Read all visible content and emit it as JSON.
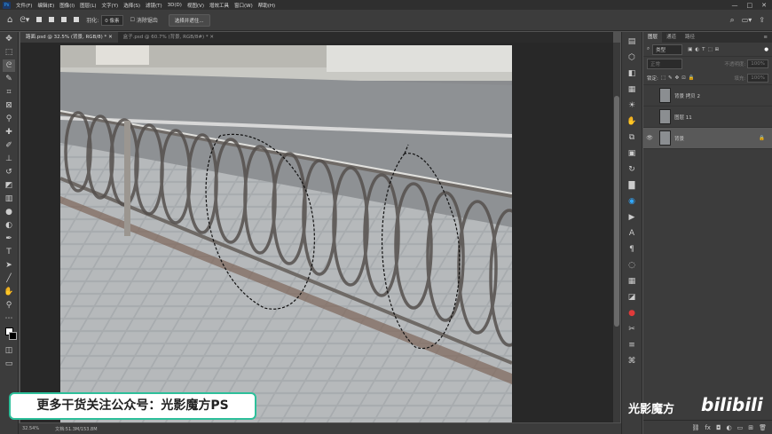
{
  "menu": {
    "app_icon": "Ps",
    "items": [
      "文件(F)",
      "编辑(E)",
      "图像(I)",
      "图层(L)",
      "文字(Y)",
      "选择(S)",
      "滤镜(T)",
      "3D(D)",
      "视图(V)",
      "增效工具",
      "窗口(W)",
      "帮助(H)"
    ]
  },
  "options": {
    "feather_label": "羽化:",
    "feather_value": "0 像素",
    "antialias_label": "消除锯齿",
    "select_subject": "选择并遮住..."
  },
  "tabs": [
    {
      "label": "路面.psd @ 32.5% (背景, RGB/8) *"
    },
    {
      "label": "盒子.psd @ 60.7% (背景, RGB/8#) *"
    }
  ],
  "layers_panel": {
    "tabs": [
      "图层",
      "通道",
      "路径"
    ],
    "filter_label": "类型",
    "blend_mode": "正常",
    "opacity_label": "不透明度:",
    "opacity_value": "100%",
    "lock_label": "锁定:",
    "fill_label": "填充:",
    "fill_value": "100%",
    "layers": [
      {
        "name": "背景 拷贝 2",
        "visible": false,
        "selected": false
      },
      {
        "name": "图层 11",
        "visible": false,
        "selected": false
      },
      {
        "name": "背景",
        "visible": true,
        "selected": true
      }
    ]
  },
  "status": {
    "zoom": "32.54%",
    "doc": "文档:51.3M/153.8M"
  },
  "watermark": "更多干货关注公众号：光影魔方PS",
  "brand_text": "光影魔方",
  "logo_text": "bilibili"
}
